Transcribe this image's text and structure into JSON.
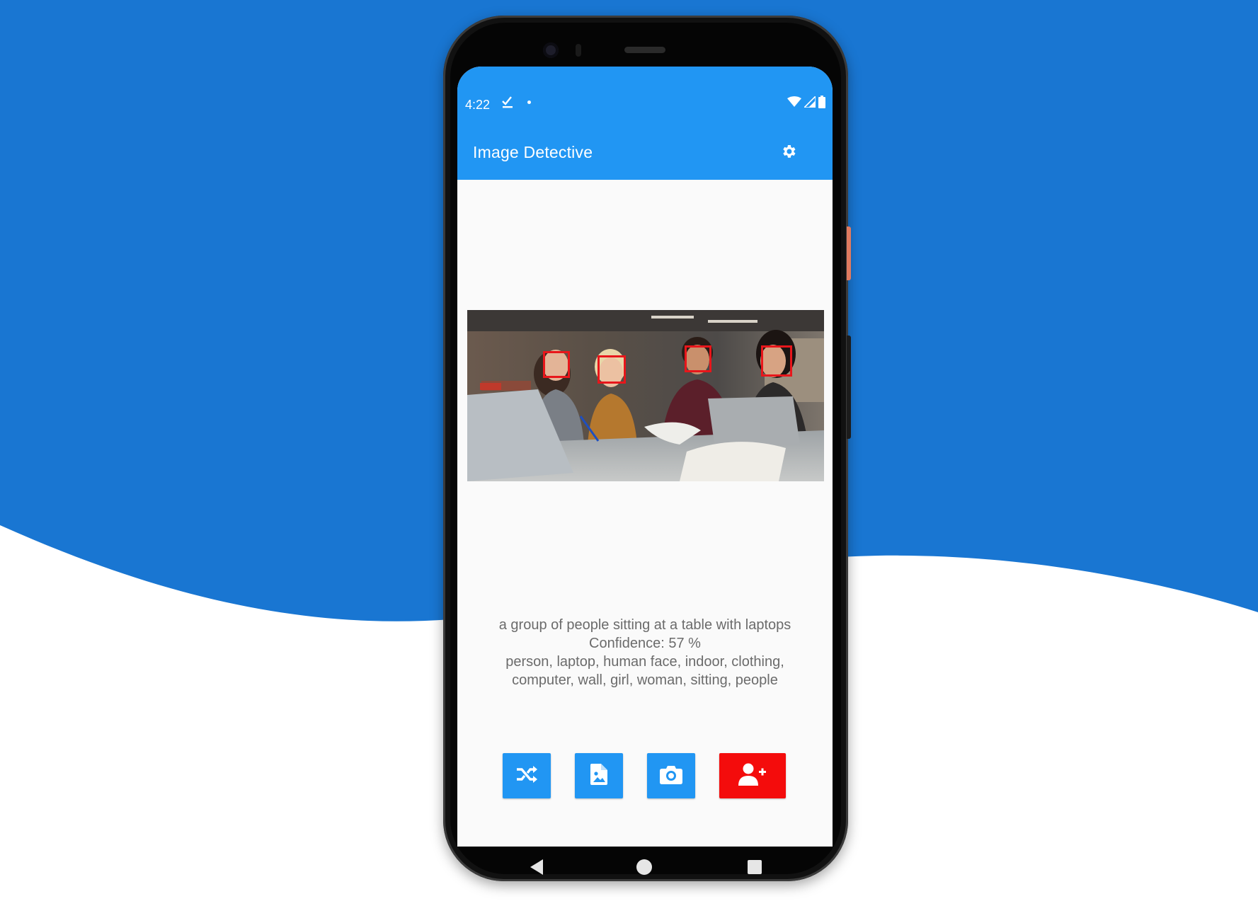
{
  "background": {
    "wave_color": "#1976d2",
    "page_color": "#ffffff"
  },
  "status_bar": {
    "time": "4:22",
    "icons": [
      "check-icon",
      "dot-icon",
      "wifi-icon",
      "signal-icon",
      "battery-icon"
    ]
  },
  "app_bar": {
    "title": "Image Detective",
    "settings_icon": "gear-icon",
    "color": "#2196f3"
  },
  "image": {
    "description_icon": "photo-with-face-boxes",
    "face_box_color": "#e8161b",
    "faces_detected": 4
  },
  "result": {
    "caption": "a group of people sitting at a table with laptops",
    "confidence": "Confidence: 57 %",
    "tags_line1": "person, laptop, human face, indoor, clothing,",
    "tags_line2": "computer, wall, girl, woman, sitting, people"
  },
  "actions": [
    {
      "name": "shuffle-button",
      "icon": "shuffle-icon",
      "color": "#2196f3"
    },
    {
      "name": "pick-image-file-button",
      "icon": "image-file-icon",
      "color": "#2196f3"
    },
    {
      "name": "camera-button",
      "icon": "camera-icon",
      "color": "#2196f3"
    },
    {
      "name": "add-person-button",
      "icon": "person-add-icon",
      "color": "#f40c0c"
    }
  ],
  "navigation": {
    "buttons": [
      "back-icon",
      "home-icon",
      "recents-icon"
    ]
  }
}
